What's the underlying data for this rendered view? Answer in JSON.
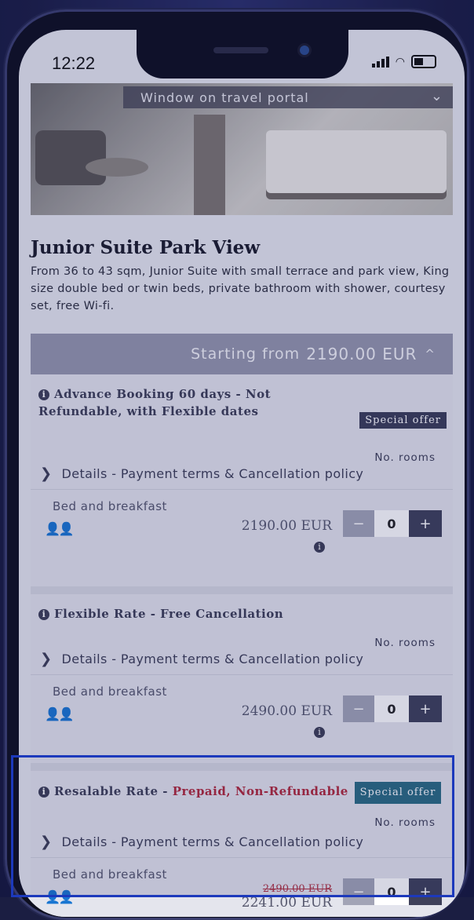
{
  "status": {
    "time": "12:22"
  },
  "hero": {
    "banner_label": "Window on travel portal"
  },
  "room": {
    "title": "Junior Suite Park View",
    "description": "From 36 to 43 sqm, Junior Suite with small terrace and park view, King size double bed or twin beds, private bathroom with shower, courtesy set, free Wi-fi."
  },
  "starting": {
    "label": "Starting from",
    "price": "2190.00 EUR"
  },
  "rates": [
    {
      "name": "Advance Booking 60 days",
      "separator": " - ",
      "subtitle": "Not Refundable, with Flexible dates",
      "badge": "Special offer",
      "norooms": "No. rooms",
      "details": "Details - Payment terms & Cancellation policy",
      "board": "Bed and breakfast",
      "price": "2190.00 EUR",
      "qty": "0"
    },
    {
      "name": "Flexible Rate",
      "separator": " - ",
      "subtitle": "Free Cancellation",
      "norooms": "No. rooms",
      "details": "Details - Payment terms & Cancellation policy",
      "board": "Bed and breakfast",
      "price": "2490.00 EUR",
      "qty": "0"
    },
    {
      "name": "Resalable Rate",
      "separator": " - ",
      "subtitle": "Prepaid, Non-Refundable",
      "badge": "Special offer",
      "norooms": "No. rooms",
      "details": "Details - Payment terms & Cancellation policy",
      "board": "Bed and breakfast",
      "old_price": "2490.00 EUR",
      "price": "2241.00 EUR",
      "qty": "0"
    }
  ],
  "icons": {
    "info": "i",
    "chevron": "❯",
    "persons": "👤👤",
    "minus": "−",
    "plus": "+",
    "banner_chevron": "⌄",
    "starting_chevron": "^"
  }
}
